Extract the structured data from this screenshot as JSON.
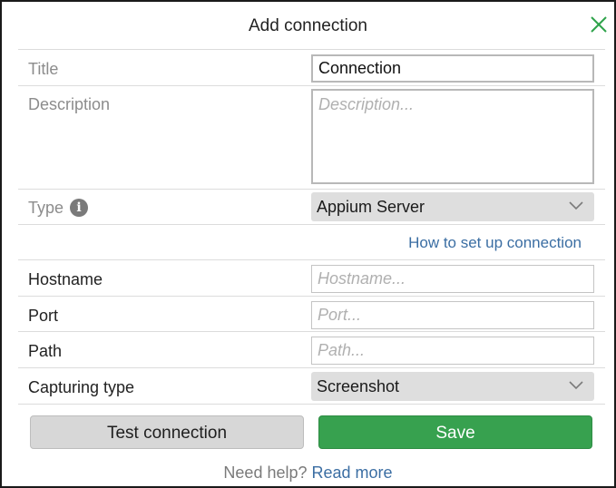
{
  "dialog": {
    "title": "Add connection",
    "close_icon": "close-icon",
    "accent_color": "#2fa34b"
  },
  "form": {
    "title": {
      "label": "Title",
      "value": "Connection"
    },
    "description": {
      "label": "Description",
      "placeholder": "Description..."
    },
    "type": {
      "label": "Type",
      "info_icon": "info-icon",
      "value": "Appium Server"
    },
    "help_link": "How to set up connection",
    "hostname": {
      "label": "Hostname",
      "placeholder": "Hostname..."
    },
    "port": {
      "label": "Port",
      "placeholder": "Port..."
    },
    "path": {
      "label": "Path",
      "placeholder": "Path..."
    },
    "capturing_type": {
      "label": "Capturing type",
      "value": "Screenshot"
    }
  },
  "buttons": {
    "test_label": "Test connection",
    "save_label": "Save",
    "save_color": "#37a14f"
  },
  "footer": {
    "text": "Need help?",
    "link": "Read more"
  }
}
